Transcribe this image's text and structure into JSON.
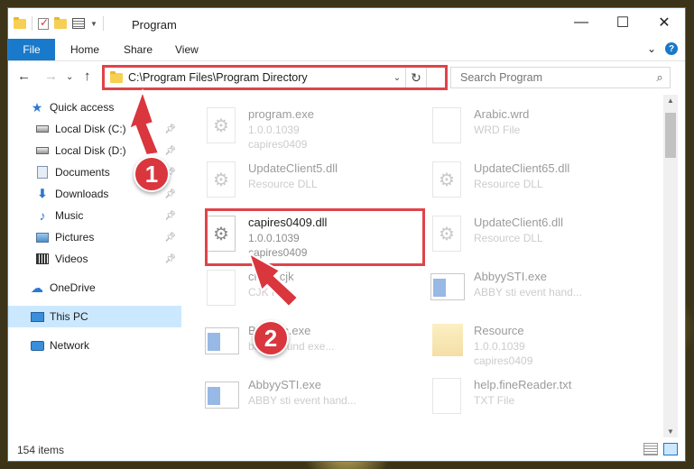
{
  "window": {
    "title": "Program",
    "controls": {
      "minimize": "—",
      "maximize": "☐",
      "close": "✕"
    }
  },
  "ribbon": {
    "tabs": [
      "File",
      "Home",
      "Share",
      "View"
    ],
    "help": "?",
    "expand": "⌄"
  },
  "navigation": {
    "back": "←",
    "forward": "→",
    "recent": "⌄",
    "up": "↑"
  },
  "address": {
    "path": "C:\\Program Files\\Program Directory",
    "dropdown": "⌄",
    "refresh": "↻"
  },
  "search": {
    "placeholder": "Search Program",
    "icon": "⌕"
  },
  "sidebar": {
    "items": [
      {
        "label": "Quick access",
        "icon": "star-icon",
        "pinned": false
      },
      {
        "label": "Local Disk (C:)",
        "icon": "disk-icon",
        "pinned": true
      },
      {
        "label": "Local Disk (D:)",
        "icon": "disk-icon",
        "pinned": true
      },
      {
        "label": "Documents",
        "icon": "documents-icon",
        "pinned": true
      },
      {
        "label": "Downloads",
        "icon": "downloads-icon",
        "pinned": true
      },
      {
        "label": "Music",
        "icon": "music-icon",
        "pinned": true
      },
      {
        "label": "Pictures",
        "icon": "pictures-icon",
        "pinned": true
      },
      {
        "label": "Videos",
        "icon": "videos-icon",
        "pinned": true
      },
      {
        "label": "OneDrive",
        "icon": "cloud-icon",
        "pinned": false
      },
      {
        "label": "This PC",
        "icon": "pc-icon",
        "pinned": false,
        "selected": true
      },
      {
        "label": "Network",
        "icon": "network-icon",
        "pinned": false
      }
    ]
  },
  "files": [
    {
      "name": "program.exe",
      "meta1": "1.0.0.1039",
      "meta2": "capires0409",
      "icon": "exe-icon"
    },
    {
      "name": "Arabic.wrd",
      "meta1": "WRD File",
      "meta2": "",
      "icon": "file-icon"
    },
    {
      "name": "UpdateClient5.dll",
      "meta1": "Resource DLL",
      "meta2": "",
      "icon": "dll-icon"
    },
    {
      "name": "UpdateClient65.dll",
      "meta1": "Resource DLL",
      "meta2": "",
      "icon": "dll-icon"
    },
    {
      "name": "capires0409.dll",
      "meta1": "1.0.0.1039",
      "meta2": "capires0409",
      "icon": "dll-icon"
    },
    {
      "name": "UpdateClient6.dll",
      "meta1": "Resource DLL",
      "meta2": "",
      "icon": "dll-icon"
    },
    {
      "name": "clean.cjk",
      "meta1": "CJK File",
      "meta2": "",
      "icon": "file-icon"
    },
    {
      "name": "AbbyySTI.exe",
      "meta1": "ABBY sti event hand...",
      "meta2": "",
      "icon": "exe-icon"
    },
    {
      "name": "BgExec.exe",
      "meta1": "background exe...",
      "meta2": "",
      "icon": "exe-icon"
    },
    {
      "name": "Resource",
      "meta1": "1.0.0.1039",
      "meta2": "capires0409",
      "icon": "folder-icon"
    },
    {
      "name": "AbbyySTI.exe",
      "meta1": "ABBY sti event hand...",
      "meta2": "",
      "icon": "exe-icon"
    },
    {
      "name": "help.fineReader.txt",
      "meta1": "TXT File",
      "meta2": "",
      "icon": "file-icon"
    }
  ],
  "status": {
    "count": "154 items"
  },
  "markers": {
    "one": "1",
    "two": "2"
  },
  "colors": {
    "accent": "#1979ca",
    "highlight": "#e0434a",
    "selected": "#cce8ff"
  }
}
